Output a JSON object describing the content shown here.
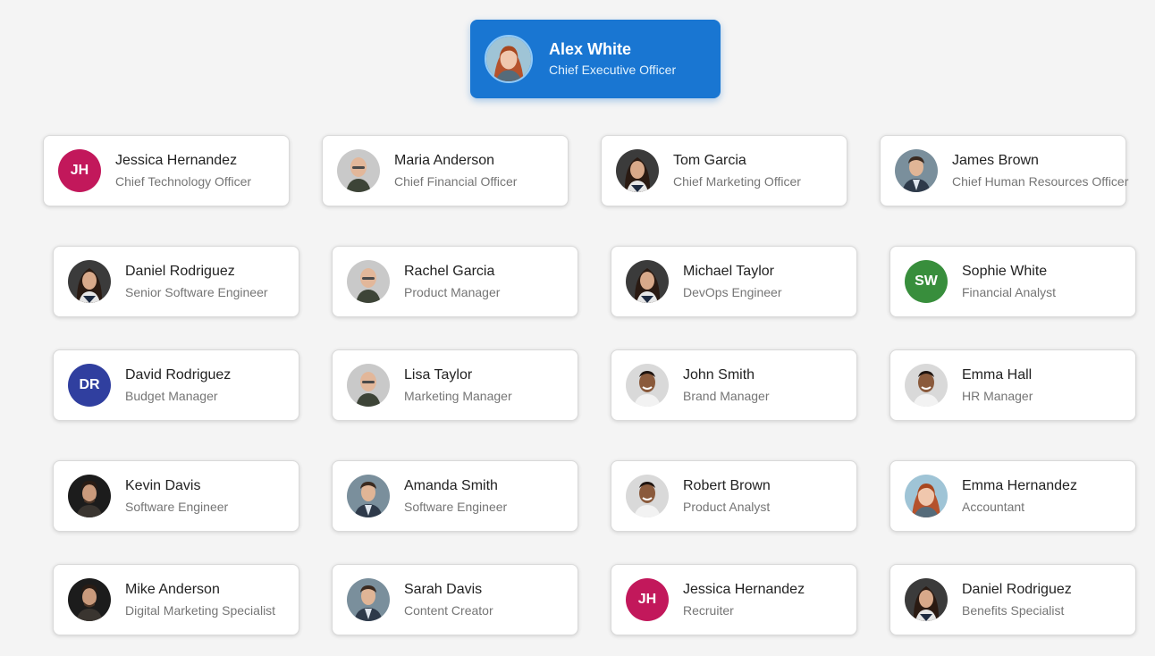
{
  "colors": {
    "accent": "#1976d2",
    "background": "#f4f4f4",
    "card": "#ffffff"
  },
  "ceo": {
    "name": "Alex White",
    "title": "Chief Executive Officer",
    "avatar": "photo-woman-red-hair-icon"
  },
  "levels": [
    [
      {
        "name": "Jessica Hernandez",
        "title": "Chief Technology Officer",
        "initials": "JH",
        "color": "#c2185b"
      },
      {
        "name": "Maria Anderson",
        "title": "Chief Financial Officer",
        "avatar": "photo-bald-man-icon"
      },
      {
        "name": "Tom Garcia",
        "title": "Chief Marketing Officer",
        "avatar": "photo-woman-dark-hair-icon"
      },
      {
        "name": "James Brown",
        "title": "Chief Human Resources Officer",
        "avatar": "photo-man-suit-icon"
      }
    ],
    [
      {
        "name": "Daniel Rodriguez",
        "title": "Senior Software Engineer",
        "avatar": "photo-woman-dark-hair-icon"
      },
      {
        "name": "Rachel Garcia",
        "title": "Product Manager",
        "avatar": "photo-bald-man-icon"
      },
      {
        "name": "Michael Taylor",
        "title": "DevOps Engineer",
        "avatar": "photo-woman-dark-hair-icon"
      },
      {
        "name": "Sophie White",
        "title": "Financial Analyst",
        "initials": "SW",
        "color": "#388e3c"
      }
    ],
    [
      {
        "name": "David Rodriguez",
        "title": "Budget Manager",
        "initials": "DR",
        "color": "#303f9f"
      },
      {
        "name": "Lisa Taylor",
        "title": "Marketing Manager",
        "avatar": "photo-bald-man-icon"
      },
      {
        "name": "John Smith",
        "title": "Brand Manager",
        "avatar": "photo-man-smiling-icon"
      },
      {
        "name": "Emma Hall",
        "title": "HR Manager",
        "avatar": "photo-man-smiling-icon"
      }
    ],
    [
      {
        "name": "Kevin Davis",
        "title": "Software Engineer",
        "avatar": "photo-man-dark-icon"
      },
      {
        "name": "Amanda Smith",
        "title": "Software Engineer",
        "avatar": "photo-man-suit-icon"
      },
      {
        "name": "Robert Brown",
        "title": "Product Analyst",
        "avatar": "photo-man-smiling-icon"
      },
      {
        "name": "Emma Hernandez",
        "title": "Accountant",
        "avatar": "photo-woman-red-hair-icon"
      }
    ],
    [
      {
        "name": "Mike Anderson",
        "title": "Digital Marketing Specialist",
        "avatar": "photo-man-dark-icon"
      },
      {
        "name": "Sarah Davis",
        "title": "Content Creator",
        "avatar": "photo-man-suit-icon"
      },
      {
        "name": "Jessica Hernandez",
        "title": "Recruiter",
        "initials": "JH",
        "color": "#c2185b"
      },
      {
        "name": "Daniel Rodriguez",
        "title": "Benefits Specialist",
        "avatar": "photo-woman-dark-hair-icon"
      }
    ]
  ]
}
